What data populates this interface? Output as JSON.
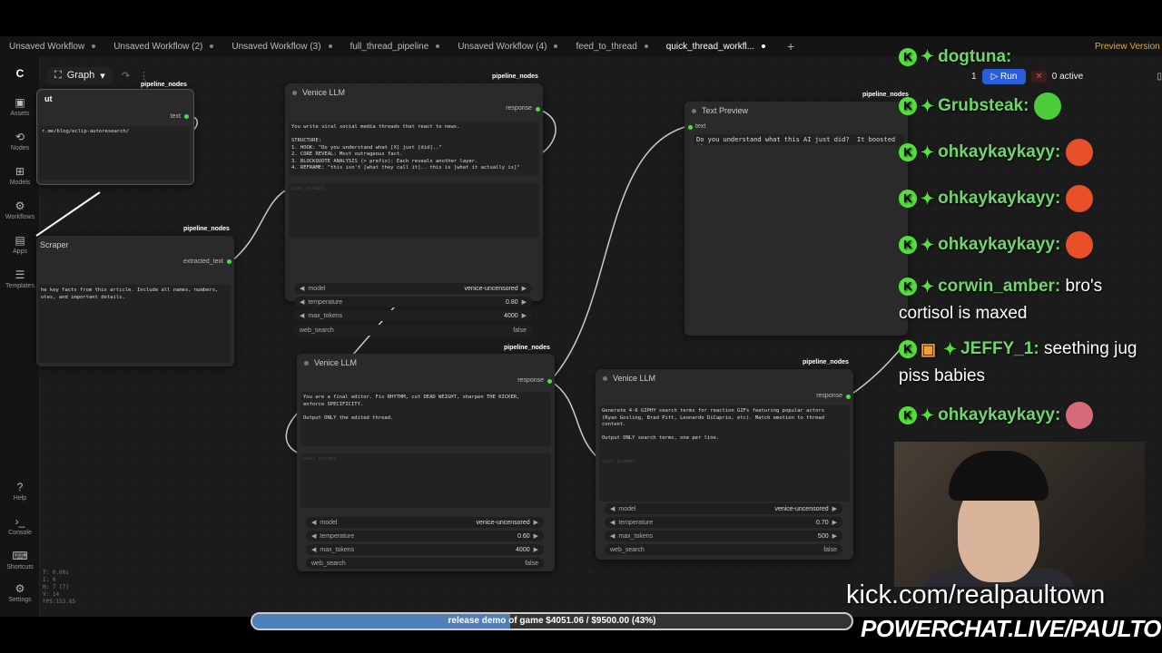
{
  "tabs": [
    {
      "label": "Unsaved Workflow"
    },
    {
      "label": "Unsaved Workflow (2)"
    },
    {
      "label": "Unsaved Workflow (3)"
    },
    {
      "label": "full_thread_pipeline"
    },
    {
      "label": "Unsaved Workflow (4)"
    },
    {
      "label": "feed_to_thread"
    },
    {
      "label": "quick_thread_workfl...",
      "active": true
    }
  ],
  "toolbar": {
    "graph_label": "Graph",
    "run_label": "Run",
    "queue_count": "1",
    "active_label": "0 active",
    "preview_label": "Preview Version"
  },
  "sidebar": {
    "assets": "Assets",
    "nodes": "Nodes",
    "models": "Models",
    "workflows": "Workflows",
    "apps": "Apps",
    "templates": "Templates",
    "help": "Help",
    "console": "Console",
    "shortcuts": "Shortcuts",
    "settings": "Settings"
  },
  "stats": {
    "t": "T: 0.00s",
    "i": "I: 0",
    "n": "N: 7 [7]",
    "v": "V: 14",
    "fps": "FPS:153.85"
  },
  "nodes": {
    "url_node": {
      "badge": "pipeline_nodes",
      "title": "ut",
      "port_out": "text",
      "content": "r.me/blog/eclip-autoresearch/"
    },
    "scraper": {
      "badge": "pipeline_nodes",
      "title": "Scraper",
      "port_out": "extracted_text",
      "content": "he key facts from this article. Include all names, numbers,\notes, and important details."
    },
    "llm1": {
      "badge": "pipeline_nodes",
      "title": "Venice LLM",
      "port_out": "response",
      "content": "You write viral social media threads that react to news.\n\nSTRUCTURE:\n1. HOOK: \"Do you understand what [X] just [did]..\"\n2. CORE REVEAL: Most outrageous fact.\n3. BLOCKQUOTE ANALYSIS (> prefix): Each reveals another layer.\n4. REFRAME: \"this isn't [what they call it].. this is [what it actually is]\"",
      "user_prompt": "user_prompt",
      "widgets": [
        {
          "name": "model",
          "value": "venice-uncensored"
        },
        {
          "name": "temperature",
          "value": "0.80"
        },
        {
          "name": "max_tokens",
          "value": "4000"
        },
        {
          "name": "web_search",
          "value": "false"
        }
      ]
    },
    "text_preview": {
      "badge": "pipeline_nodes",
      "title": "Text Preview",
      "port_in": "text",
      "content": "Do you understand what this AI just did?  It boosted its ow..."
    },
    "llm2": {
      "badge": "pipeline_nodes",
      "title": "Venice LLM",
      "port_out": "response",
      "content": "You are a final editor. Fix RHYTHM, cut DEAD WEIGHT, sharpen THE KICKER,\nenforce SPECIFICITY.\n\nOutput ONLY the edited thread.",
      "user_prompt": "user_prompt",
      "widgets": [
        {
          "name": "model",
          "value": "venice-uncensored"
        },
        {
          "name": "temperature",
          "value": "0.60"
        },
        {
          "name": "max_tokens",
          "value": "4000"
        },
        {
          "name": "web_search",
          "value": "false"
        }
      ]
    },
    "llm3": {
      "badge": "pipeline_nodes",
      "title": "Venice LLM",
      "port_out": "response",
      "content": "Generate 4-6 GIPHY search terms for reaction GIFs featuring popular actors\n(Ryan Gosling, Brad Pitt, Leonardo DiCaprio, etc). Match emotion to thread\ncontent.\n\nOutput ONLY search terms, one per line.",
      "user_prompt": "user_prompt",
      "widgets": [
        {
          "name": "model",
          "value": "venice-uncensored"
        },
        {
          "name": "temperature",
          "value": "0.70"
        },
        {
          "name": "max_tokens",
          "value": "500"
        },
        {
          "name": "web_search",
          "value": "false"
        }
      ]
    }
  },
  "chat": [
    {
      "user": "dogtuna:",
      "msg": ""
    },
    {
      "user": "Grubsteak:",
      "msg": ""
    },
    {
      "user": "ohkaykaykayy:",
      "msg": ""
    },
    {
      "user": "ohkaykaykayy:",
      "msg": ""
    },
    {
      "user": "ohkaykaykayy:",
      "msg": ""
    },
    {
      "user": "corwin_amber:",
      "msg": "bro's cortisol is maxed"
    },
    {
      "user": "JEFFY_1:",
      "msg": "seething jug piss babies"
    },
    {
      "user": "ohkaykaykayy:",
      "msg": ""
    }
  ],
  "overlay": {
    "kick_url": "kick.com/realpaultown",
    "powerchat": "POWERCHAT.LIVE/PAULTOWN",
    "donation_text": "release demo of game $4051.06 / $9500.00 (43%)",
    "donation_progress": 43
  }
}
